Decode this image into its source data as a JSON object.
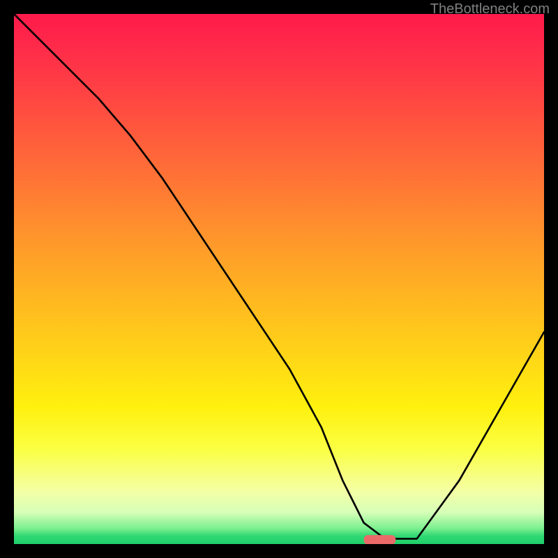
{
  "watermark": "TheBottleneck.com",
  "chart_data": {
    "type": "line",
    "title": "",
    "xlabel": "",
    "ylabel": "",
    "xlim": [
      0,
      100
    ],
    "ylim": [
      0,
      100
    ],
    "grid": false,
    "legend": false,
    "background_gradient": {
      "direction": "vertical",
      "stops": [
        {
          "pos": 0,
          "color": "#ff1a4a"
        },
        {
          "pos": 0.28,
          "color": "#ff6a38"
        },
        {
          "pos": 0.52,
          "color": "#ffb222"
        },
        {
          "pos": 0.74,
          "color": "#fff00e"
        },
        {
          "pos": 0.9,
          "color": "#f4ffa5"
        },
        {
          "pos": 0.97,
          "color": "#7df090"
        },
        {
          "pos": 1.0,
          "color": "#1fcf6a"
        }
      ]
    },
    "series": [
      {
        "name": "bottleneck-curve",
        "color": "#000000",
        "x": [
          0,
          8,
          16,
          22,
          28,
          36,
          44,
          52,
          58,
          62,
          66,
          70,
          76,
          84,
          92,
          100
        ],
        "y": [
          100,
          92,
          84,
          77,
          69,
          57,
          45,
          33,
          22,
          12,
          4,
          1,
          1,
          12,
          26,
          40
        ]
      }
    ],
    "marker": {
      "name": "optimal-point",
      "shape": "rounded-bar",
      "color": "#ea6a6a",
      "x_range": [
        66,
        72
      ],
      "y": 0.8
    }
  }
}
